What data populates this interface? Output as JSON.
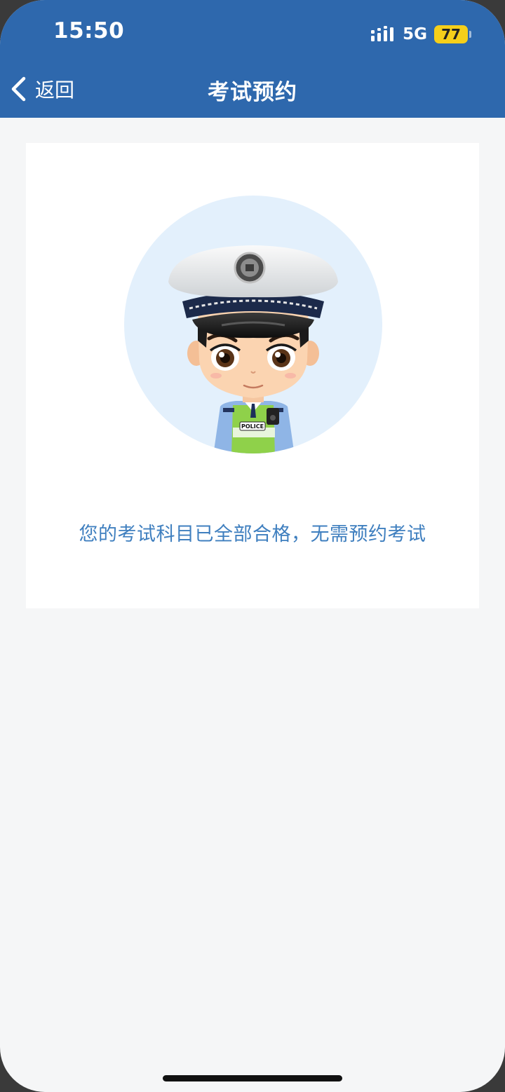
{
  "status_bar": {
    "time": "15:50",
    "network": "5G",
    "battery": "77"
  },
  "nav": {
    "back_label": "返回",
    "title": "考试预约"
  },
  "content": {
    "badge_text": "POLICE",
    "message": "您的考试科目已全部合格，无需预约考试"
  },
  "colors": {
    "header": "#2e68ad",
    "message": "#3f7fbf",
    "page_bg": "#f5f6f7",
    "circle_bg": "#e3f0fc",
    "battery": "#f5cf1a"
  },
  "icons": {
    "back": "chevron-left-icon",
    "signal": "signal-icon",
    "battery": "battery-icon"
  }
}
